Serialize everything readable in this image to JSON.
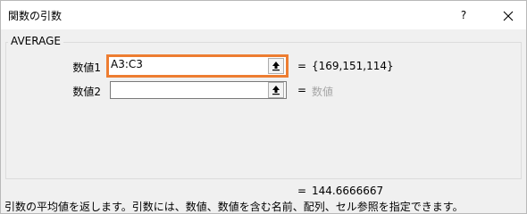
{
  "window": {
    "title": "関数の引数",
    "help_label": "?"
  },
  "function": {
    "name": "AVERAGE",
    "args": [
      {
        "label": "数値1",
        "value": "A3:C3",
        "result": "{169,151,114}"
      },
      {
        "label": "数値2",
        "value": "",
        "result": "数値"
      }
    ],
    "equals": "="
  },
  "formula": {
    "result": "144.6666667",
    "description": "引数の平均値を返します。引数には、数値、数値を含む名前、配列、セル参照を指定できます。"
  },
  "colors": {
    "active_border": "#ed7d31",
    "dialog_bg": "#f0f0f0",
    "placeholder_text": "#a6a6a6"
  }
}
